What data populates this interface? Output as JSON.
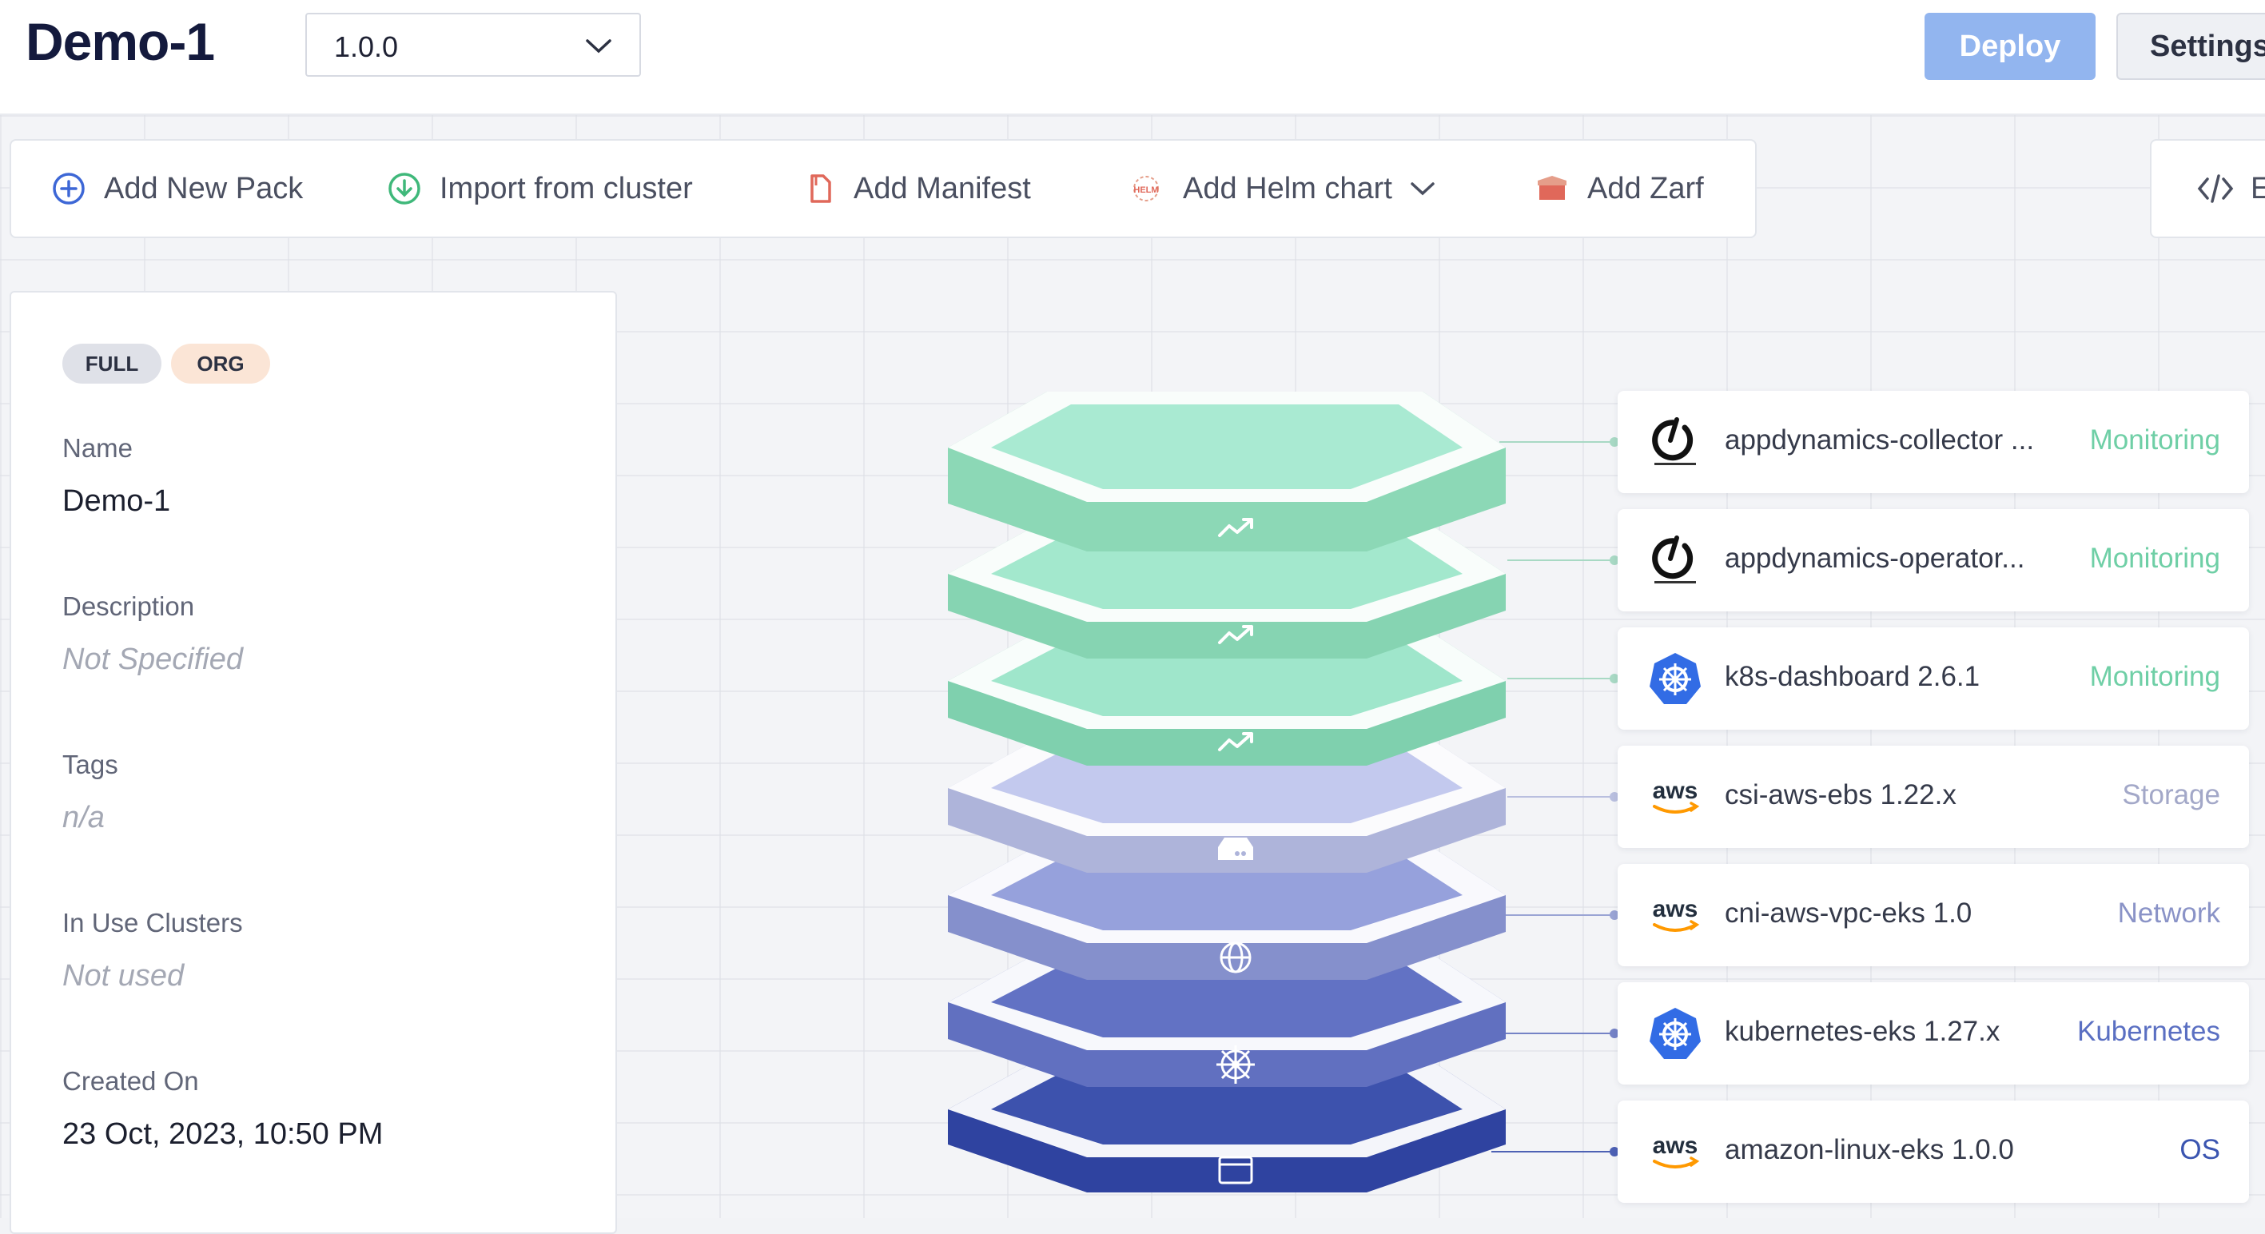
{
  "header": {
    "title": "Demo-1",
    "version": "1.0.0",
    "deploy_label": "Deploy",
    "settings_label": "Settings"
  },
  "toolbar": {
    "add_new_pack": "Add New Pack",
    "import_from_cluster": "Import from cluster",
    "add_manifest": "Add Manifest",
    "add_helm_chart": "Add Helm chart",
    "add_zarf": "Add Zarf",
    "editor": "E"
  },
  "profile": {
    "badges": [
      "FULL",
      "ORG"
    ],
    "name_label": "Name",
    "name_value": "Demo-1",
    "description_label": "Description",
    "description_value": "Not Specified",
    "tags_label": "Tags",
    "tags_value": "n/a",
    "clusters_label": "In Use Clusters",
    "clusters_value": "Not used",
    "created_label": "Created On",
    "created_value": "23 Oct, 2023, 10:50 PM"
  },
  "packs": [
    {
      "name": "appdynamics-collector ...",
      "type": "Monitoring",
      "logo": "appdynamics-logo",
      "type_color": "#6fcfa6"
    },
    {
      "name": "appdynamics-operator...",
      "type": "Monitoring",
      "logo": "appdynamics-logo",
      "type_color": "#6fcfa6"
    },
    {
      "name": "k8s-dashboard 2.6.1",
      "type": "Monitoring",
      "logo": "kubernetes-logo",
      "type_color": "#6fcfa6"
    },
    {
      "name": "csi-aws-ebs 1.22.x",
      "type": "Storage",
      "logo": "aws-logo",
      "type_color": "#a3a8c8"
    },
    {
      "name": "cni-aws-vpc-eks 1.0",
      "type": "Network",
      "logo": "aws-logo",
      "type_color": "#8a93c7"
    },
    {
      "name": "kubernetes-eks 1.27.x",
      "type": "Kubernetes",
      "logo": "kubernetes-logo",
      "type_color": "#5a6fc2"
    },
    {
      "name": "amazon-linux-eks 1.0.0",
      "type": "OS",
      "logo": "aws-logo",
      "type_color": "#3b55b0"
    }
  ],
  "colors": {
    "monitoring": "#9fe6cb",
    "storage": "#c3c9ee",
    "network": "#97a3dc",
    "kubernetes": "#6374c4",
    "os": "#3f55ad",
    "deploy": "#92b5ef"
  },
  "icons": [
    "plus-circle-icon",
    "download-circle-icon",
    "file-icon",
    "helm-icon",
    "chevron-down-icon",
    "box-icon",
    "code-icon",
    "trend-icon",
    "storage-icon",
    "globe-icon",
    "helm-wheel-icon",
    "window-icon"
  ]
}
